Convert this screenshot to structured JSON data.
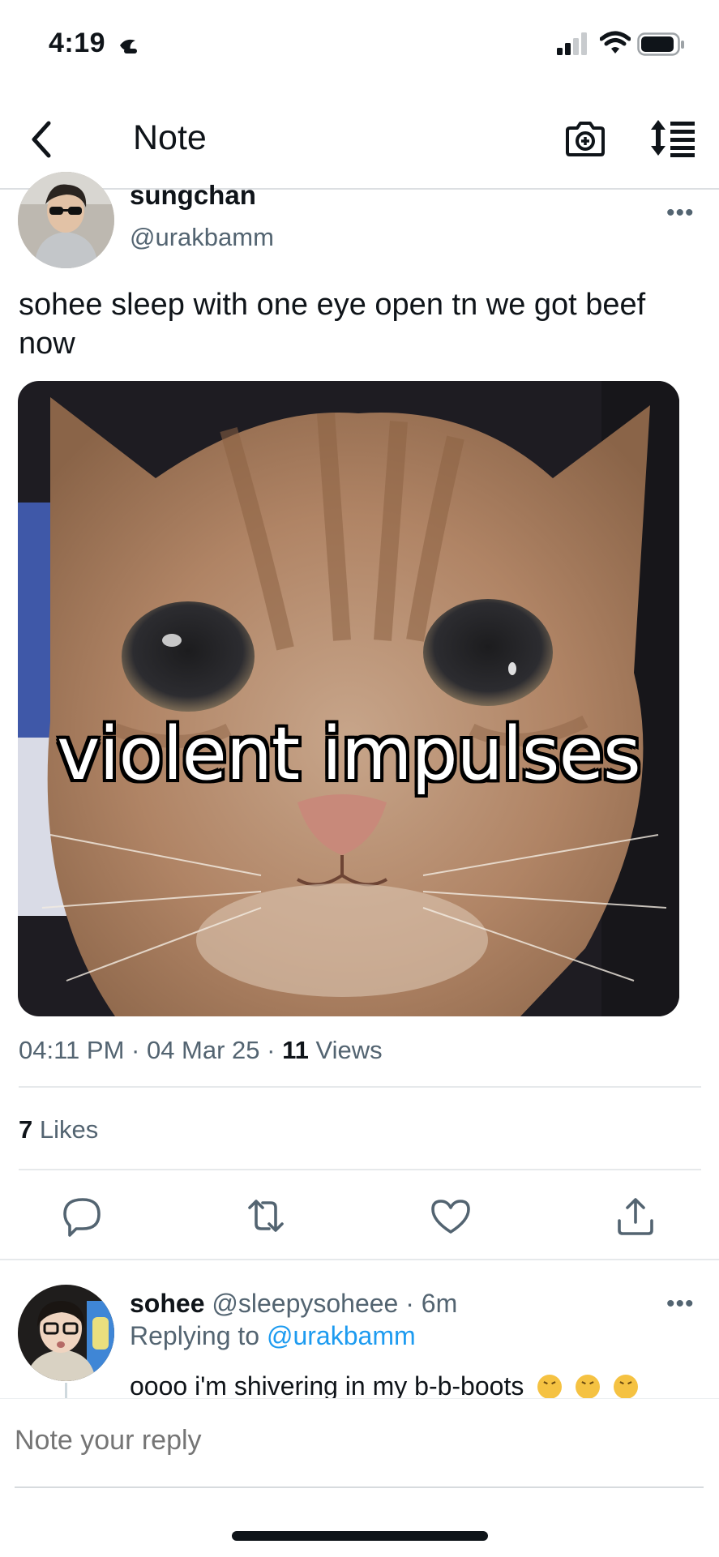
{
  "status_bar": {
    "time": "4:19",
    "focus_icon": "moon-icon",
    "signal_icon": "cellular-signal-icon",
    "wifi_icon": "wifi-icon",
    "battery_icon": "battery-icon"
  },
  "header": {
    "title": "Note",
    "back_icon": "chevron-left-icon",
    "camera_icon": "camera-add-icon",
    "sort_icon": "sort-order-icon"
  },
  "note": {
    "author_name": "sungchan",
    "author_handle": "@urakbamm",
    "text": "sohee sleep with one eye open tn we got beef now",
    "media_caption": "violent impulses",
    "time": "04:11 PM",
    "date": "04 Mar 25",
    "views_count": "11",
    "views_label": "Views",
    "likes_count": "7",
    "likes_label": "Likes",
    "more_label": "•••"
  },
  "actions": [
    {
      "name": "reply-icon"
    },
    {
      "name": "renote-icon"
    },
    {
      "name": "like-heart-icon"
    },
    {
      "name": "share-icon"
    }
  ],
  "reply": {
    "author_name": "sohee",
    "author_handle": "@sleepysoheee",
    "age": "· 6m",
    "replying_prefix": "Replying to",
    "replying_handle": "@urakbamm",
    "text": "oooo i'm shivering in my b-b-boots",
    "emoji": "confounded-face",
    "more_label": "•••"
  },
  "composer": {
    "placeholder": "Note your reply"
  },
  "colors": {
    "accent": "#1d9bf0",
    "text_primary": "#0f1419",
    "text_secondary": "#536471",
    "divider": "#e6e9eb"
  }
}
